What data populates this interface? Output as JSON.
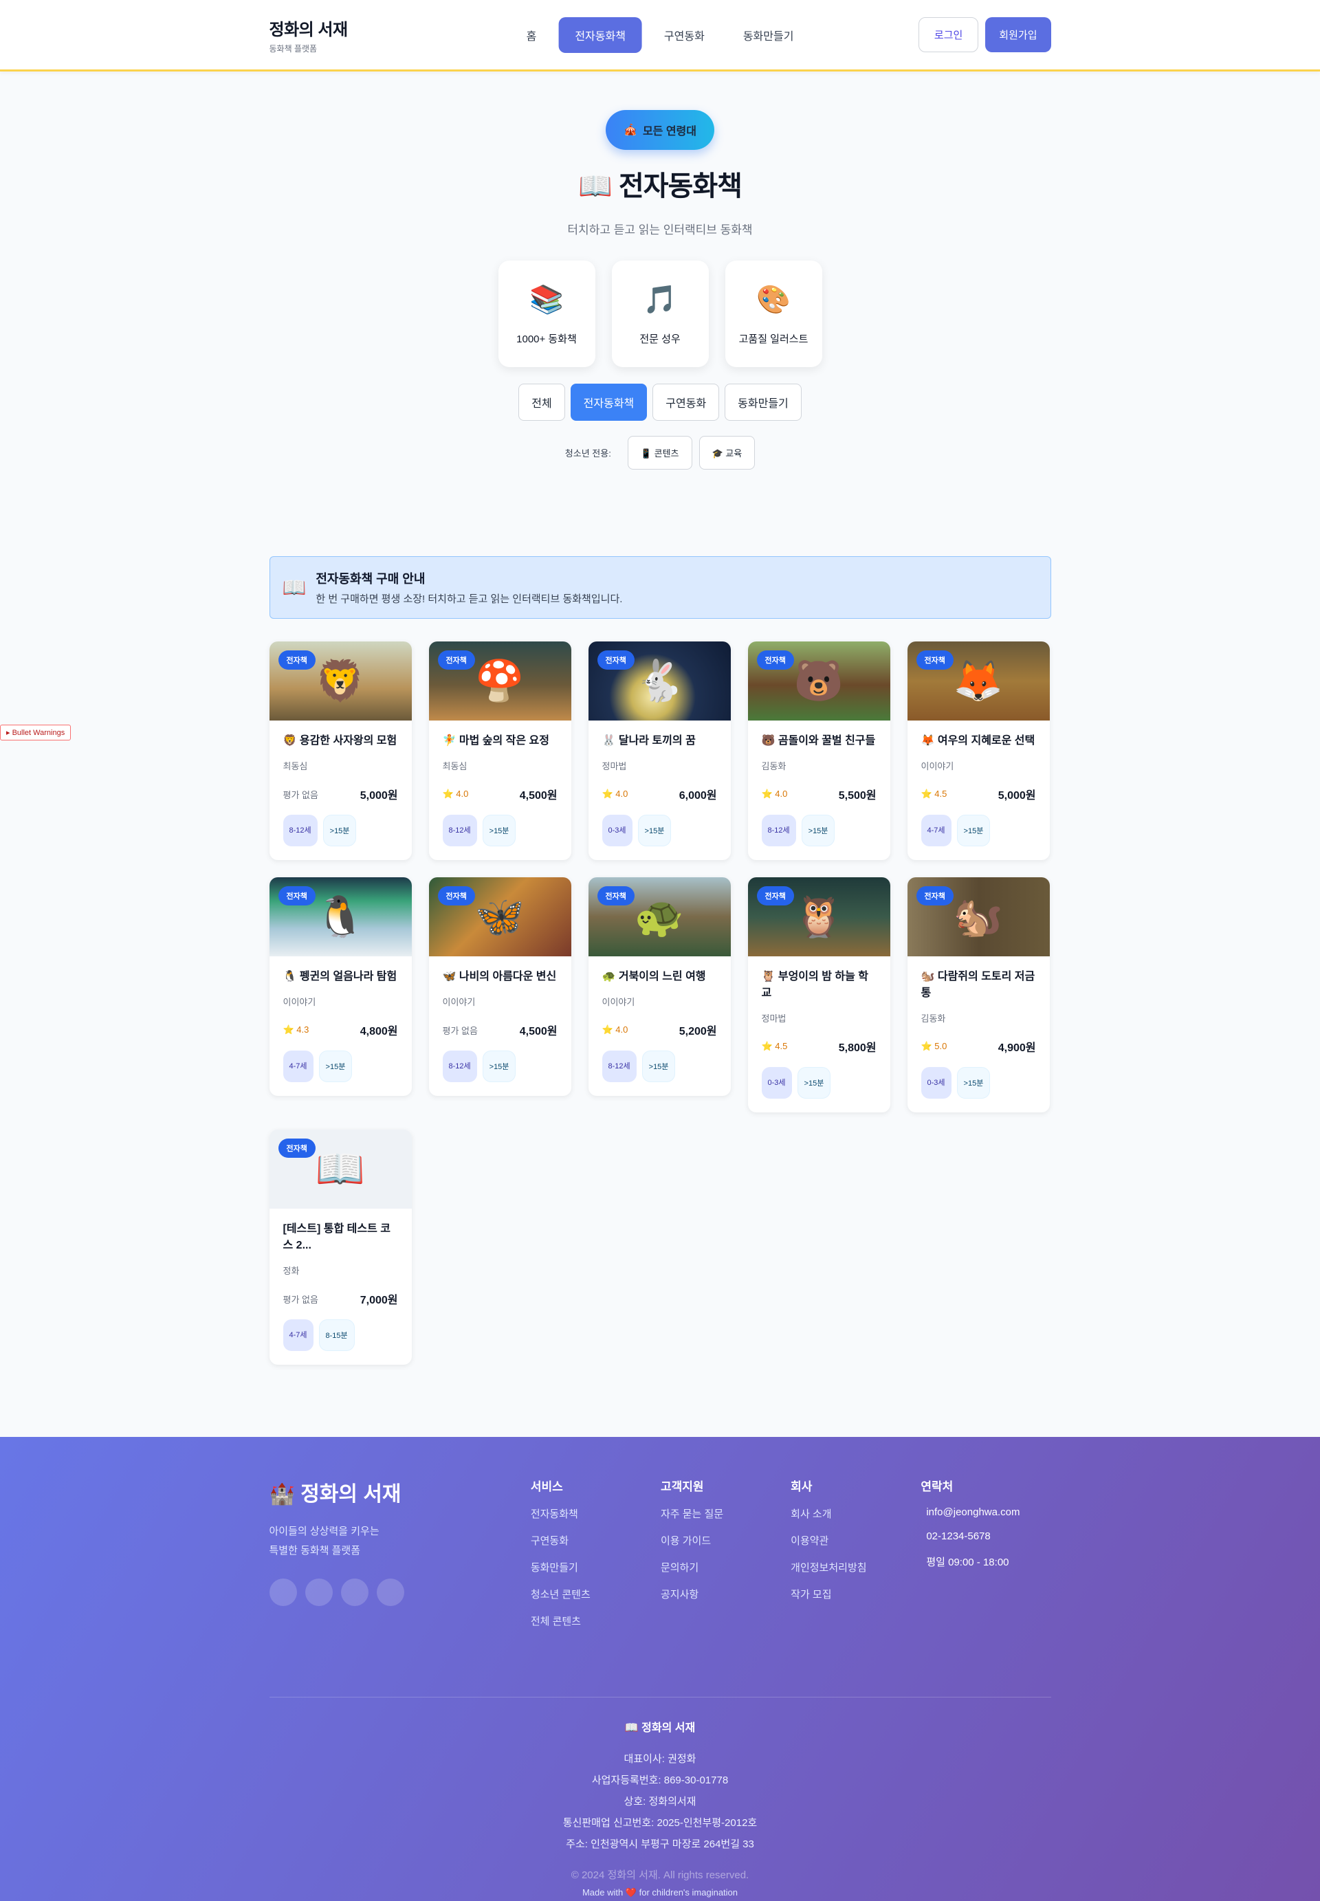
{
  "header": {
    "brand": "정화의 서재",
    "brand_sub": "동화책 플랫폼",
    "nav": [
      {
        "label": "홈",
        "active": false
      },
      {
        "label": "전자동화책",
        "active": true
      },
      {
        "label": "구연동화",
        "active": false
      },
      {
        "label": "동화만들기",
        "active": false
      }
    ],
    "login": "로그인",
    "signup": "회원가입"
  },
  "hero": {
    "age_pill": "모든 연령대",
    "age_icon": "🎪",
    "title": "📖 전자동화책",
    "desc": "터치하고 듣고 읽는 인터랙티브 동화책",
    "features": [
      {
        "icon": "📚",
        "label": "1000+ 동화책"
      },
      {
        "icon": "🎵",
        "label": "전문 성우"
      },
      {
        "icon": "🎨",
        "label": "고품질 일러스트"
      }
    ],
    "tabs": [
      {
        "label": "전체",
        "active": false
      },
      {
        "label": "전자동화책",
        "active": true
      },
      {
        "label": "구연동화",
        "active": false
      },
      {
        "label": "동화만들기",
        "active": false
      }
    ],
    "teen_label": "청소년 전용:",
    "teen_chips": [
      "📱 콘텐츠",
      "🎓 교육"
    ]
  },
  "notice": {
    "icon": "📖",
    "title": "전자동화책 구매 안내",
    "desc": "한 번 구매하면 평생 소장! 터치하고 듣고 읽는 인터랙티브 동화책입니다."
  },
  "warning": "▸ Bullet Warnings",
  "books": [
    {
      "badge": "전자책",
      "title": "🦁 용감한 사자왕의 모험",
      "author": "최동심",
      "rating": "평가 없음",
      "rated": false,
      "price": "5,000원",
      "age": "8-12세",
      "time": ">15분",
      "scene": "🦁",
      "bg": "linear-gradient(180deg,#cfd6c0 0%,#b8935a 60%,#6b5a3a 100%)"
    },
    {
      "badge": "전자책",
      "title": "🧚 마법 숲의 작은 요정",
      "author": "최동심",
      "rating": "⭐ 4.0",
      "rated": true,
      "price": "4,500원",
      "age": "8-12세",
      "time": ">15분",
      "scene": "🍄",
      "bg": "linear-gradient(180deg,#2f4a4a 0%,#6b5a3a 55%,#c08a4a 100%)"
    },
    {
      "badge": "전자책",
      "title": "🐰 달나라 토끼의 꿈",
      "author": "정마법",
      "rating": "⭐ 4.0",
      "rated": true,
      "price": "6,000원",
      "age": "0-3세",
      "time": ">15분",
      "scene": "🐇",
      "bg": "radial-gradient(circle at 45% 70%,#f3e7a8 0%,#c9b45a 22%,#1e3050 45%,#0f1c35 100%)"
    },
    {
      "badge": "전자책",
      "title": "🐻 곰돌이와 꿀벌 친구들",
      "author": "김동화",
      "rating": "⭐ 4.0",
      "rated": true,
      "price": "5,500원",
      "age": "8-12세",
      "time": ">15분",
      "scene": "🐻",
      "bg": "linear-gradient(180deg,#8fae6a 0%,#6b4a2a 55%,#4a7a3a 100%)"
    },
    {
      "badge": "전자책",
      "title": "🦊 여우의 지혜로운 선택",
      "author": "이이야기",
      "rating": "⭐ 4.5",
      "rated": true,
      "price": "5,000원",
      "age": "4-7세",
      "time": ">15분",
      "scene": "🦊",
      "bg": "linear-gradient(180deg,#6a5a3a 0%,#a27a3a 50%,#8a5a2a 100%)"
    },
    {
      "badge": "전자책",
      "title": "🐧 펭귄의 얼음나라 탐험",
      "author": "이이야기",
      "rating": "⭐ 4.3",
      "rated": true,
      "price": "4,800원",
      "age": "4-7세",
      "time": ">15분",
      "scene": "🐧",
      "bg": "linear-gradient(180deg,#1d3a4a 0%,#3aa37a 30%,#a8c8d8 65%,#e8eef2 100%)"
    },
    {
      "badge": "전자책",
      "title": "🦋 나비의 아름다운 변신",
      "author": "이이야기",
      "rating": "평가 없음",
      "rated": false,
      "price": "4,500원",
      "age": "8-12세",
      "time": ">15분",
      "scene": "🦋",
      "bg": "linear-gradient(135deg,#2f5a3a 0%,#c98a3a 45%,#7a3a2a 100%)"
    },
    {
      "badge": "전자책",
      "title": "🐢 거북이의 느린 여행",
      "author": "이이야기",
      "rating": "⭐ 4.0",
      "rated": true,
      "price": "5,200원",
      "age": "8-12세",
      "time": ">15분",
      "scene": "🐢",
      "bg": "linear-gradient(180deg,#a7c0c8 0%,#7a6a4a 50%,#3a5a3a 100%)"
    },
    {
      "badge": "전자책",
      "title": "🦉 부엉이의 밤 하늘 학교",
      "author": "정마법",
      "rating": "⭐ 4.5",
      "rated": true,
      "price": "5,800원",
      "age": "0-3세",
      "time": ">15분",
      "scene": "🦉",
      "bg": "linear-gradient(180deg,#1f3a3a 0%,#3a5a4a 50%,#8a6a3a 100%)"
    },
    {
      "badge": "전자책",
      "title": "🐿️ 다람쥐의 도토리 저금통",
      "author": "김동화",
      "rating": "⭐ 5.0",
      "rated": true,
      "price": "4,900원",
      "age": "0-3세",
      "time": ">15분",
      "scene": "🐿️",
      "bg": "linear-gradient(90deg,#8a7a5a 0%,#5a4a32 50%,#6a5a3a 100%)"
    },
    {
      "badge": "전자책",
      "title": "[테스트] 통합 테스트 코스 2...",
      "author": "정화",
      "rating": "평가 없음",
      "rated": false,
      "price": "7,000원",
      "age": "4-7세",
      "time": "8-15분",
      "scene": "📖",
      "bg": "#eef2f6"
    }
  ],
  "footer": {
    "brand": "🏰 정화의 서재",
    "tagline_1": "아이들의 상상력을 키우는",
    "tagline_2": "특별한 동화책 플랫폼",
    "columns": [
      {
        "title": "서비스",
        "links": [
          "전자동화책",
          "구연동화",
          "동화만들기",
          "청소년 콘텐츠",
          "전체 콘텐츠"
        ]
      },
      {
        "title": "고객지원",
        "links": [
          "자주 묻는 질문",
          "이용 가이드",
          "문의하기",
          "공지사항"
        ]
      },
      {
        "title": "회사",
        "links": [
          "회사 소개",
          "이용약관",
          "개인정보처리방침",
          "작가 모집"
        ]
      }
    ],
    "contact_title": "연락처",
    "contact": [
      "info@jeonghwa.com",
      "02-1234-5678",
      "평일 09:00 - 18:00"
    ],
    "bottom_name": "📖 정화의 서재",
    "bottom_info": [
      "대표이사: 권정화",
      "사업자등록번호: 869-30-01778",
      "상호: 정화의서재",
      "통신판매업 신고번호: 2025-인천부평-2012호",
      "주소: 인천광역시 부평구 마장로 264번길 33"
    ],
    "copyright": "© 2024 정화의 서재. All rights reserved.",
    "made": "Made with ❤️ for children's imagination"
  }
}
